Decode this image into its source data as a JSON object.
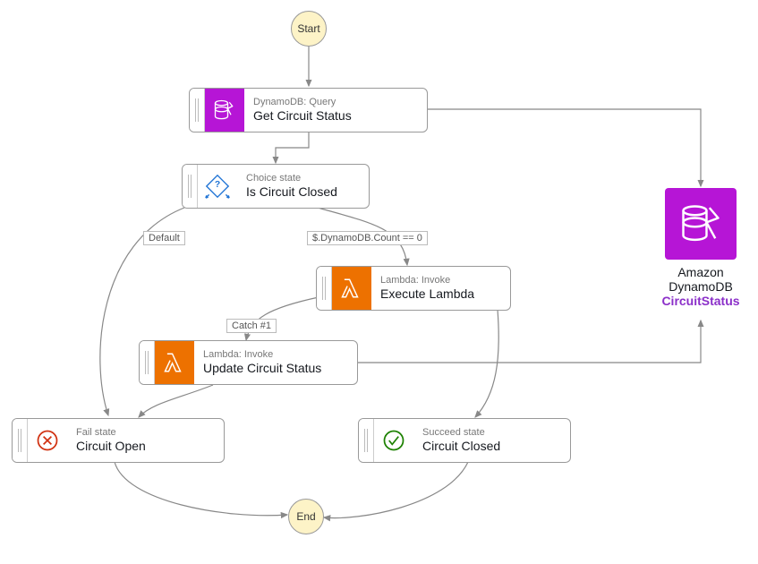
{
  "start": {
    "label": "Start"
  },
  "end": {
    "label": "End"
  },
  "states": {
    "getCircuit": {
      "subtitle": "DynamoDB: Query",
      "title": "Get Circuit Status"
    },
    "isClosed": {
      "subtitle": "Choice state",
      "title": "Is Circuit Closed"
    },
    "executeLambda": {
      "subtitle": "Lambda: Invoke",
      "title": "Execute Lambda"
    },
    "updateCircuit": {
      "subtitle": "Lambda: Invoke",
      "title": "Update Circuit Status"
    },
    "circuitOpen": {
      "subtitle": "Fail state",
      "title": "Circuit Open"
    },
    "circuitClosed": {
      "subtitle": "Succeed state",
      "title": "Circuit Closed"
    }
  },
  "edgeLabels": {
    "default": "Default",
    "countZero": "$.DynamoDB.Count == 0",
    "catch1": "Catch #1"
  },
  "resource": {
    "line1": "Amazon",
    "line2": "DynamoDB",
    "line3": "CircuitStatus"
  }
}
